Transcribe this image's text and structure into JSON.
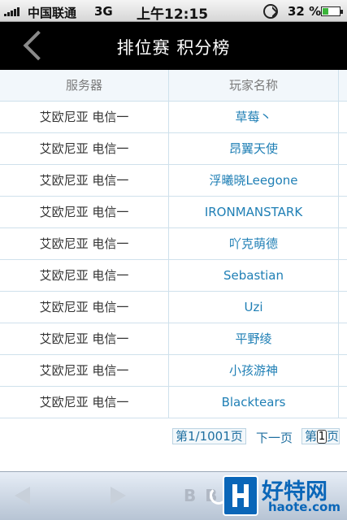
{
  "status_bar": {
    "carrier": "中国联通",
    "network": "3G",
    "time": "上午12:15",
    "battery_percent": "32 %",
    "battery_level": 0.32
  },
  "header": {
    "title": "排位赛 积分榜",
    "back_icon": "chevron-left-icon"
  },
  "table": {
    "columns": [
      "服务器",
      "玩家名称"
    ],
    "rows": [
      {
        "server": "艾欧尼亚 电信一",
        "player": "草莓丶"
      },
      {
        "server": "艾欧尼亚 电信一",
        "player": "昂翼天使"
      },
      {
        "server": "艾欧尼亚 电信一",
        "player": "浮曦晓Leegone"
      },
      {
        "server": "艾欧尼亚 电信一",
        "player": "IRONMANSTARK"
      },
      {
        "server": "艾欧尼亚 电信一",
        "player": "吖克萌德"
      },
      {
        "server": "艾欧尼亚 电信一",
        "player": "Sebastian"
      },
      {
        "server": "艾欧尼亚 电信一",
        "player": "Uzi"
      },
      {
        "server": "艾欧尼亚 电信一",
        "player": "平野绫"
      },
      {
        "server": "艾欧尼亚 电信一",
        "player": "小孩游神"
      },
      {
        "server": "艾欧尼亚 电信一",
        "player": "Blacktears"
      }
    ]
  },
  "pagination": {
    "current_page_label": "第1/1001页",
    "next_label": "下一页",
    "jump_prefix": "第",
    "jump_value": "1",
    "jump_suffix": "页"
  },
  "toolbar": {
    "bookmarks_glyph": "B B"
  },
  "watermark": {
    "name": "好特网",
    "url": "haote.com"
  },
  "colors": {
    "link": "#1f7fb5",
    "title_bar": "#000000",
    "grid": "#cfe1ec"
  }
}
